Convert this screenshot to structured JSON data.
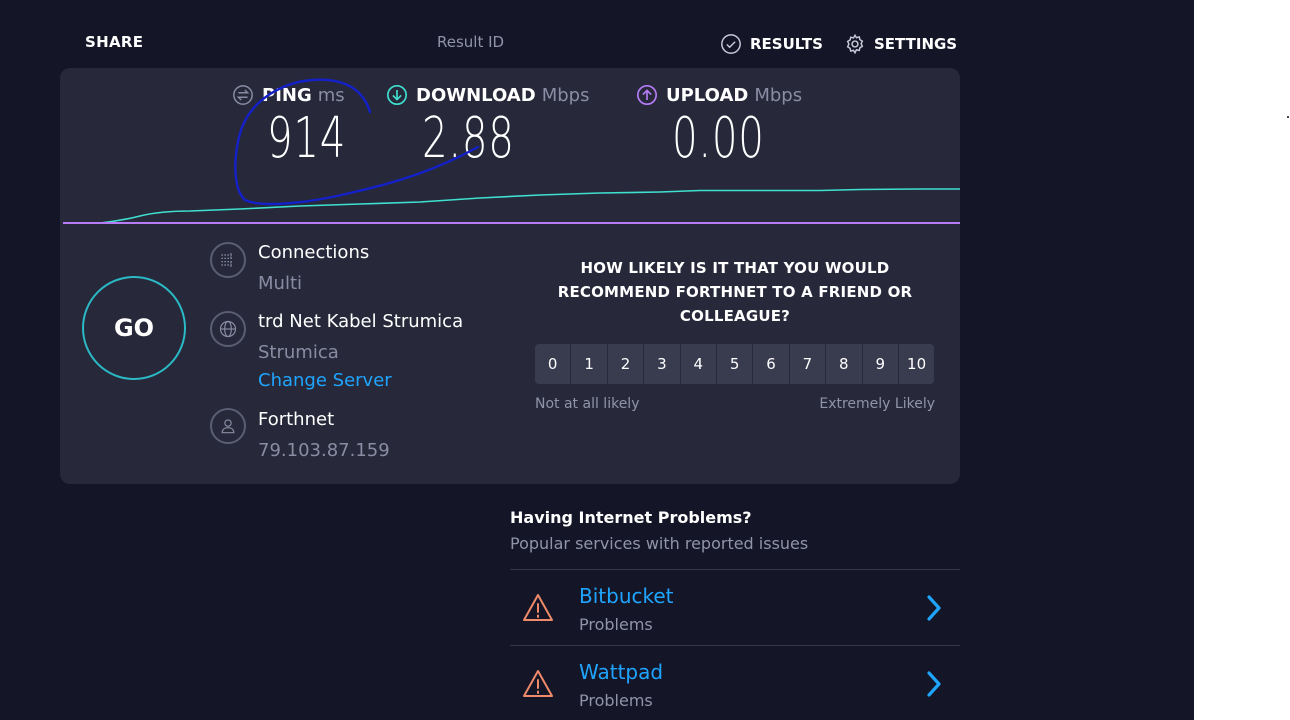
{
  "header": {
    "share_label": "SHARE",
    "result_id_label": "Result ID",
    "results_label": "RESULTS",
    "settings_label": "SETTINGS"
  },
  "metrics": {
    "ping": {
      "label": "PING",
      "unit": "ms",
      "value": "914"
    },
    "download": {
      "label": "DOWNLOAD",
      "unit": "Mbps",
      "value": "2.88"
    },
    "upload": {
      "label": "UPLOAD",
      "unit": "Mbps",
      "value": "0.00"
    }
  },
  "go_label": "GO",
  "connections": {
    "label": "Connections",
    "value": "Multi"
  },
  "server": {
    "name": "trd Net Kabel Strumica",
    "location": "Strumica",
    "change_label": "Change Server"
  },
  "provider": {
    "name": "Forthnet",
    "ip": "79.103.87.159"
  },
  "survey": {
    "question": "HOW LIKELY IS IT THAT YOU WOULD RECOMMEND FORTHNET TO A FRIEND OR COLLEAGUE?",
    "options": [
      "0",
      "1",
      "2",
      "3",
      "4",
      "5",
      "6",
      "7",
      "8",
      "9",
      "10"
    ],
    "low_label": "Not at all likely",
    "high_label": "Extremely Likely"
  },
  "problems": {
    "title": "Having Internet Problems?",
    "subtitle": "Popular services with reported issues",
    "items": [
      {
        "name": "Bitbucket",
        "status": "Problems"
      },
      {
        "name": "Wattpad",
        "status": "Problems"
      }
    ]
  },
  "colors": {
    "background": "#141526",
    "panel": "#27293a",
    "download_accent": "#3fe0d0",
    "upload_accent": "#b67cf6",
    "link": "#1fa5ff",
    "warning": "#ef8a6a",
    "annotation_ink": "#1420c8"
  }
}
